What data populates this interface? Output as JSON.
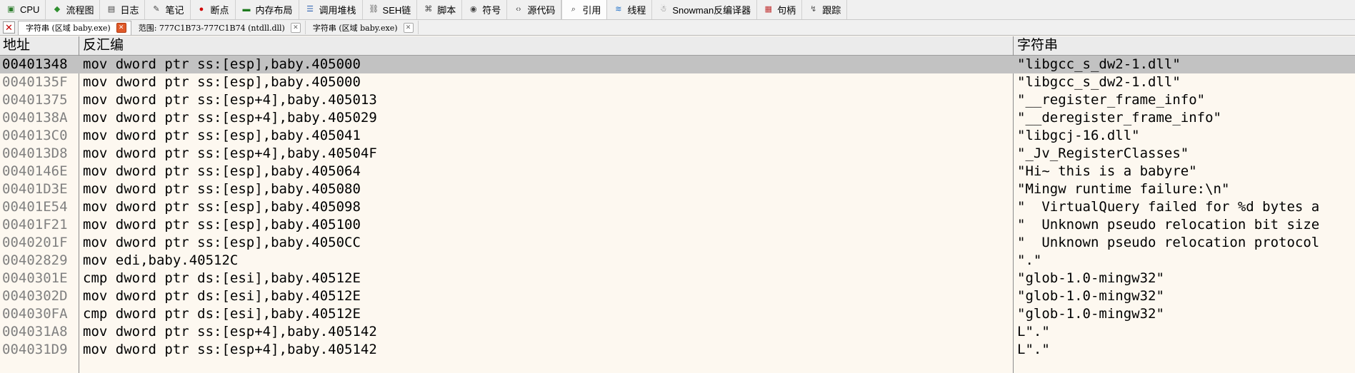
{
  "tabs": [
    {
      "label": "CPU",
      "icon": "cpu-icon"
    },
    {
      "label": "流程图",
      "icon": "flowchart-icon"
    },
    {
      "label": "日志",
      "icon": "log-icon"
    },
    {
      "label": "笔记",
      "icon": "notes-icon"
    },
    {
      "label": "断点",
      "icon": "breakpoint-icon"
    },
    {
      "label": "内存布局",
      "icon": "memory-map-icon"
    },
    {
      "label": "调用堆栈",
      "icon": "call-stack-icon"
    },
    {
      "label": "SEH链",
      "icon": "seh-chain-icon"
    },
    {
      "label": "脚本",
      "icon": "script-icon"
    },
    {
      "label": "符号",
      "icon": "symbols-icon"
    },
    {
      "label": "源代码",
      "icon": "source-icon"
    },
    {
      "label": "引用",
      "icon": "references-icon",
      "active": true
    },
    {
      "label": "线程",
      "icon": "threads-icon"
    },
    {
      "label": "Snowman反编译器",
      "icon": "snowman-icon"
    },
    {
      "label": "句柄",
      "icon": "handles-icon"
    },
    {
      "label": "跟踪",
      "icon": "trace-icon"
    }
  ],
  "subtabs": [
    {
      "label": "字符串 (区域 baby.exe)",
      "active": true
    },
    {
      "label": "范围: 777C1B73-777C1B74 (ntdll.dll)"
    },
    {
      "label": "字符串 (区域 baby.exe)"
    }
  ],
  "columns": {
    "address": "地址",
    "disassembly": "反汇编",
    "string": "字符串"
  },
  "rows": [
    {
      "addr": "00401348",
      "dis": "mov dword ptr ss:[esp],baby.405000",
      "str": "\"libgcc_s_dw2-1.dll\"",
      "selected": true
    },
    {
      "addr": "0040135F",
      "dis": "mov dword ptr ss:[esp],baby.405000",
      "str": "\"libgcc_s_dw2-1.dll\""
    },
    {
      "addr": "00401375",
      "dis": "mov dword ptr ss:[esp+4],baby.405013",
      "str": "\"__register_frame_info\""
    },
    {
      "addr": "0040138A",
      "dis": "mov dword ptr ss:[esp+4],baby.405029",
      "str": "\"__deregister_frame_info\""
    },
    {
      "addr": "004013C0",
      "dis": "mov dword ptr ss:[esp],baby.405041",
      "str": "\"libgcj-16.dll\""
    },
    {
      "addr": "004013D8",
      "dis": "mov dword ptr ss:[esp+4],baby.40504F",
      "str": "\"_Jv_RegisterClasses\""
    },
    {
      "addr": "0040146E",
      "dis": "mov dword ptr ss:[esp],baby.405064",
      "str": "\"Hi~ this is a babyre\""
    },
    {
      "addr": "00401D3E",
      "dis": "mov dword ptr ss:[esp],baby.405080",
      "str": "\"Mingw runtime failure:\\n\""
    },
    {
      "addr": "00401E54",
      "dis": "mov dword ptr ss:[esp],baby.405098",
      "str": "\"  VirtualQuery failed for %d bytes a"
    },
    {
      "addr": "00401F21",
      "dis": "mov dword ptr ss:[esp],baby.405100",
      "str": "\"  Unknown pseudo relocation bit size"
    },
    {
      "addr": "0040201F",
      "dis": "mov dword ptr ss:[esp],baby.4050CC",
      "str": "\"  Unknown pseudo relocation protocol"
    },
    {
      "addr": "00402829",
      "dis": "mov edi,baby.40512C",
      "str": "\".\""
    },
    {
      "addr": "0040301E",
      "dis": "cmp dword ptr ds:[esi],baby.40512E",
      "str": "\"glob-1.0-mingw32\""
    },
    {
      "addr": "0040302D",
      "dis": "mov dword ptr ds:[esi],baby.40512E",
      "str": "\"glob-1.0-mingw32\""
    },
    {
      "addr": "004030FA",
      "dis": "cmp dword ptr ds:[esi],baby.40512E",
      "str": "\"glob-1.0-mingw32\""
    },
    {
      "addr": "004031A8",
      "dis": "mov dword ptr ss:[esp+4],baby.405142",
      "str": "L\".\""
    },
    {
      "addr": "004031D9",
      "dis": "mov dword ptr ss:[esp+4],baby.405142",
      "str": "L\".\""
    }
  ],
  "colors": {
    "background": "#fdf8f0",
    "selected_row": "#c2c2c2",
    "address_text": "#808080",
    "tab_close_active": "#e05a2a"
  }
}
